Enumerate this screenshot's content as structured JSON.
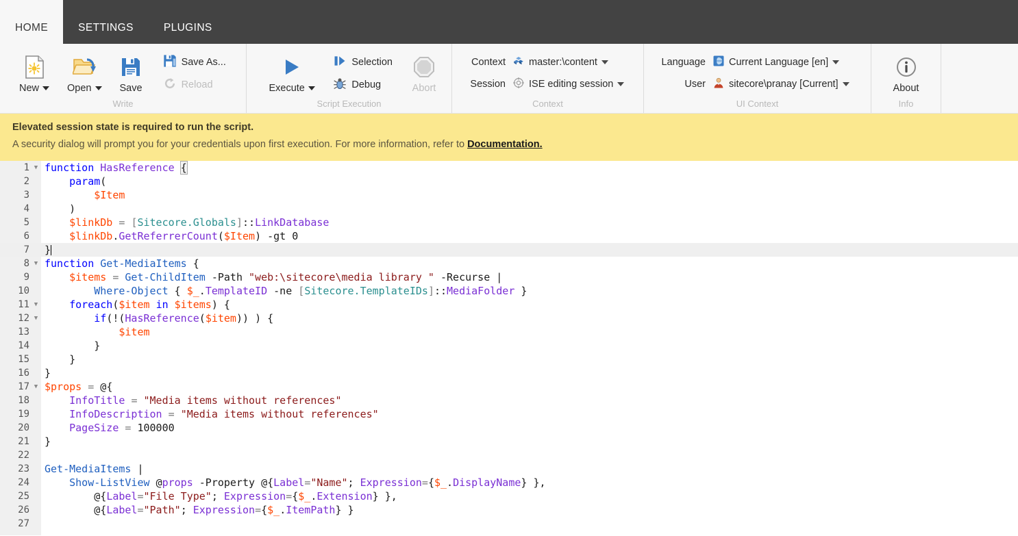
{
  "tabs": [
    {
      "label": "HOME",
      "active": true
    },
    {
      "label": "SETTINGS",
      "active": false
    },
    {
      "label": "PLUGINS",
      "active": false
    }
  ],
  "ribbon": {
    "groups": [
      {
        "name": "write",
        "label": "Write",
        "buttons": {
          "new": "New",
          "open": "Open",
          "save": "Save",
          "save_as": "Save As...",
          "reload": "Reload"
        }
      },
      {
        "name": "script-execution",
        "label": "Script Execution",
        "buttons": {
          "execute": "Execute",
          "selection": "Selection",
          "debug": "Debug",
          "abort": "Abort"
        }
      },
      {
        "name": "context",
        "label": "Context",
        "rows": {
          "context_label": "Context",
          "context_value": "master:\\content",
          "session_label": "Session",
          "session_value": "ISE editing session"
        }
      },
      {
        "name": "ui-context",
        "label": "UI Context",
        "rows": {
          "language_label": "Language",
          "language_value": "Current Language [en]",
          "user_label": "User",
          "user_value": "sitecore\\pranay [Current]"
        }
      },
      {
        "name": "info",
        "label": "Info",
        "buttons": {
          "about": "About"
        }
      }
    ]
  },
  "banner": {
    "title": "Elevated session state is required to run the script.",
    "text_before": "A security dialog will prompt you for your credentials upon first execution. For more information, refer to ",
    "link": "Documentation."
  },
  "editor": {
    "active_line": 7,
    "total_rows": 27,
    "lines": [
      {
        "n": 1,
        "fold": true,
        "text": "function HasReference {"
      },
      {
        "n": 2,
        "fold": false,
        "text": "    param("
      },
      {
        "n": 3,
        "fold": false,
        "text": "        $Item"
      },
      {
        "n": 4,
        "fold": false,
        "text": "    )"
      },
      {
        "n": 5,
        "fold": false,
        "text": "    $linkDb = [Sitecore.Globals]::LinkDatabase"
      },
      {
        "n": 6,
        "fold": false,
        "text": "    $linkDb.GetReferrerCount($Item) -gt 0"
      },
      {
        "n": 7,
        "fold": false,
        "text": "}"
      },
      {
        "n": 8,
        "fold": true,
        "text": "function Get-MediaItems {"
      },
      {
        "n": 9,
        "fold": false,
        "text": "    $items = Get-ChildItem -Path \"web:\\sitecore\\media library \" -Recurse |"
      },
      {
        "n": 10,
        "fold": false,
        "text": "        Where-Object { $_.TemplateID -ne [Sitecore.TemplateIDs]::MediaFolder }"
      },
      {
        "n": 11,
        "fold": true,
        "text": "    foreach($item in $items) {"
      },
      {
        "n": 12,
        "fold": true,
        "text": "        if(!(HasReference($item)) ) {"
      },
      {
        "n": 13,
        "fold": false,
        "text": "            $item"
      },
      {
        "n": 14,
        "fold": false,
        "text": "        }"
      },
      {
        "n": 15,
        "fold": false,
        "text": "    }"
      },
      {
        "n": 16,
        "fold": false,
        "text": "}"
      },
      {
        "n": 17,
        "fold": true,
        "text": "$props = @{"
      },
      {
        "n": 18,
        "fold": false,
        "text": "    InfoTitle = \"Media items without references\""
      },
      {
        "n": 19,
        "fold": false,
        "text": "    InfoDescription = \"Media items without references\""
      },
      {
        "n": 20,
        "fold": false,
        "text": "    PageSize = 100000"
      },
      {
        "n": 21,
        "fold": false,
        "text": "}"
      },
      {
        "n": 22,
        "fold": false,
        "text": ""
      },
      {
        "n": 23,
        "fold": false,
        "text": "Get-MediaItems |"
      },
      {
        "n": 24,
        "fold": false,
        "text": "    Show-ListView @props -Property @{Label=\"Name\"; Expression={$_.DisplayName} },"
      },
      {
        "n": 25,
        "fold": false,
        "text": "        @{Label=\"File Type\"; Expression={$_.Extension} },"
      },
      {
        "n": 26,
        "fold": false,
        "text": "        @{Label=\"Path\"; Expression={$_.ItemPath} }"
      },
      {
        "n": 27,
        "fold": false,
        "text": ""
      }
    ]
  },
  "colors": {
    "tabbar_bg": "#434343",
    "ribbon_bg": "#f7f7f7",
    "banner_bg": "#fbe88f",
    "accent_blue": "#3a7cc4",
    "active_line": "#efefef",
    "gutter_bg": "#f0f0f0"
  },
  "icons": {
    "new": "new-document-icon",
    "open": "open-folder-icon",
    "save": "floppy-disk-icon",
    "save_as": "floppy-disk-plus-icon",
    "reload": "refresh-icon",
    "execute": "play-triangle-icon",
    "selection": "run-selection-icon",
    "debug": "bug-icon",
    "abort": "octagon-stop-icon",
    "context": "database-cubes-icon",
    "session": "target-icon",
    "language": "globe-icon",
    "user": "person-icon",
    "about": "info-circle-icon"
  }
}
